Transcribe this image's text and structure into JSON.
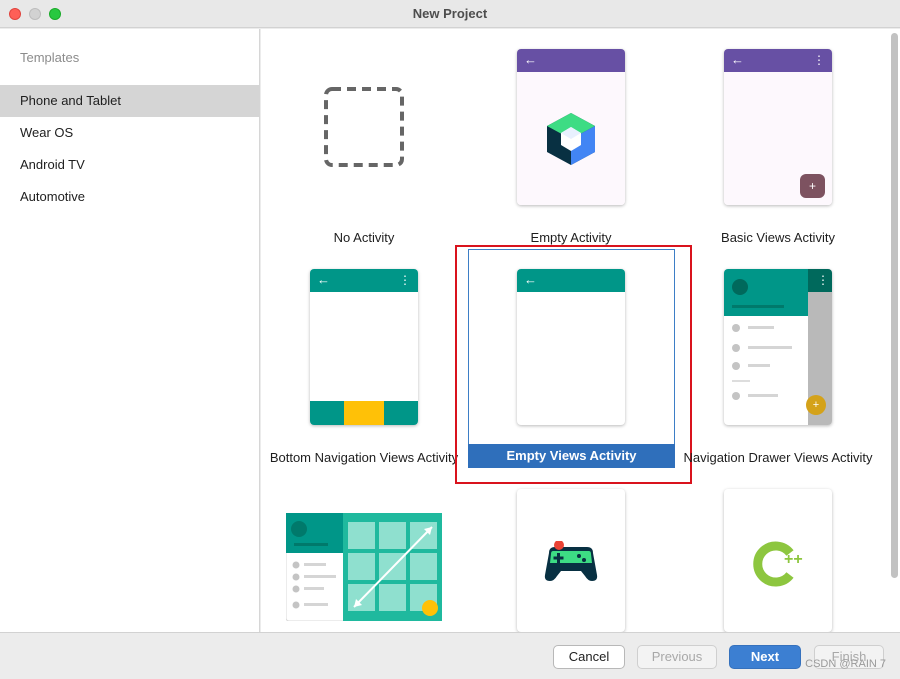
{
  "window": {
    "title": "New Project"
  },
  "sidebar": {
    "header": "Templates",
    "items": [
      {
        "label": "Phone and Tablet",
        "selected": true
      },
      {
        "label": "Wear OS",
        "selected": false
      },
      {
        "label": "Android TV",
        "selected": false
      },
      {
        "label": "Automotive",
        "selected": false
      }
    ]
  },
  "templates": [
    {
      "label": "No Activity",
      "icon": "dashed-square-icon"
    },
    {
      "label": "Empty Activity",
      "icon": "jetpack-compose-icon"
    },
    {
      "label": "Basic Views Activity",
      "icon": "phone-fab-icon"
    },
    {
      "label": "Bottom Navigation Views Activity",
      "icon": "phone-bottom-nav-icon"
    },
    {
      "label": "Empty Views Activity",
      "icon": "phone-blank-icon",
      "selected": true
    },
    {
      "label": "Navigation Drawer Views Activity",
      "icon": "phone-nav-drawer-icon"
    },
    {
      "label": "",
      "icon": "responsive-grid-icon"
    },
    {
      "label": "",
      "icon": "game-controller-icon"
    },
    {
      "label": "",
      "icon": "cpp-icon"
    }
  ],
  "icons": {
    "back": "←",
    "overflow": "⋮",
    "fab_plus": "+"
  },
  "cpp": {
    "plus_text": "++"
  },
  "footer": {
    "cancel": "Cancel",
    "previous": "Previous",
    "next": "Next",
    "finish": "Finish"
  },
  "watermark": "CSDN @RAIN 7",
  "colors": {
    "accent": "#3c7fd2",
    "selection": "#2f6fbb",
    "highlight": "#d9131d",
    "teal": "#009688",
    "purple": "#6750a4",
    "amber": "#ffc107"
  }
}
